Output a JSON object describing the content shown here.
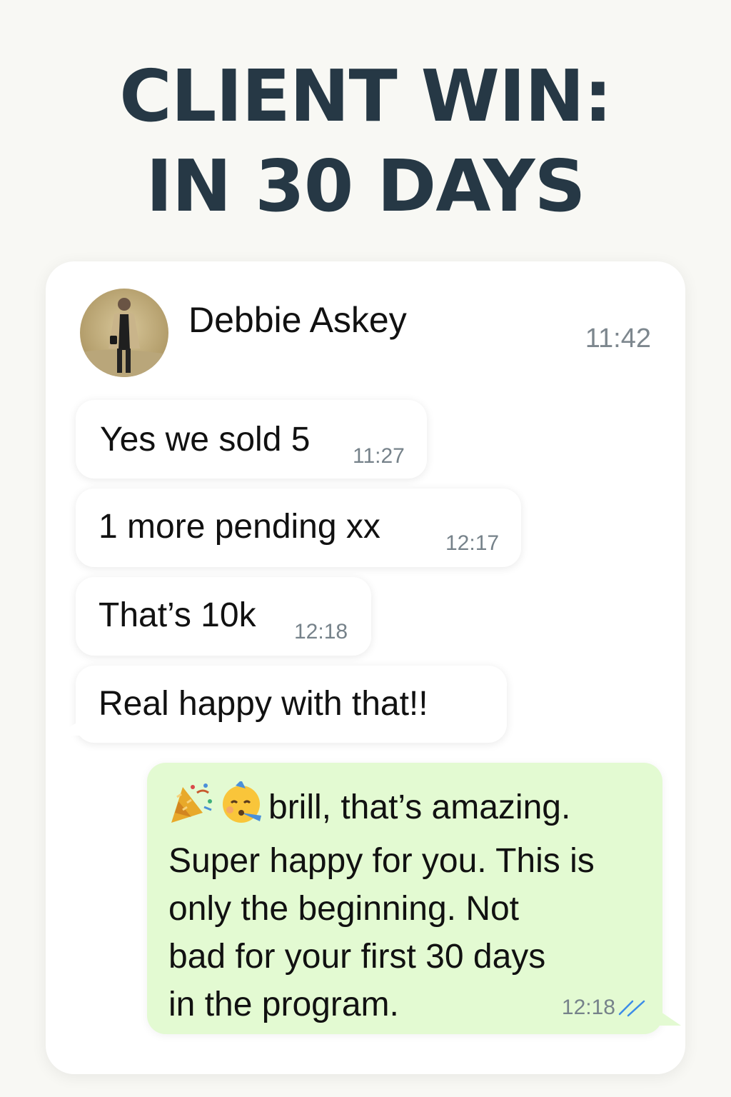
{
  "headline": {
    "line1": "CLIENT WIN:",
    "line2": "IN 30 DAYS"
  },
  "chat": {
    "contact_name": "Debbie Askey",
    "header_time": "11:42",
    "messages": [
      {
        "direction": "incoming",
        "text": "Yes we sold 5",
        "time": "11:27"
      },
      {
        "direction": "incoming",
        "text": "1 more pending xx",
        "time": "12:17"
      },
      {
        "direction": "incoming",
        "text": "That’s 10k",
        "time": "12:18"
      },
      {
        "direction": "incoming",
        "text": "Real happy with that!!",
        "time": ""
      }
    ],
    "reply": {
      "direction": "outgoing",
      "emojis": [
        "party-popper-icon",
        "partying-face-icon"
      ],
      "lines": [
        "brill, that’s amazing.",
        "Super happy for you. This is",
        "only the beginning. Not",
        "bad for your first 30 days",
        "in the program."
      ],
      "time": "12:18",
      "status": "read"
    }
  },
  "colors": {
    "background": "#f8f8f4",
    "headline": "#263845",
    "card": "#ffffff",
    "outgoing_bubble": "#e3fad2",
    "read_tick": "#3b8ce8",
    "timestamp": "#76828a"
  }
}
